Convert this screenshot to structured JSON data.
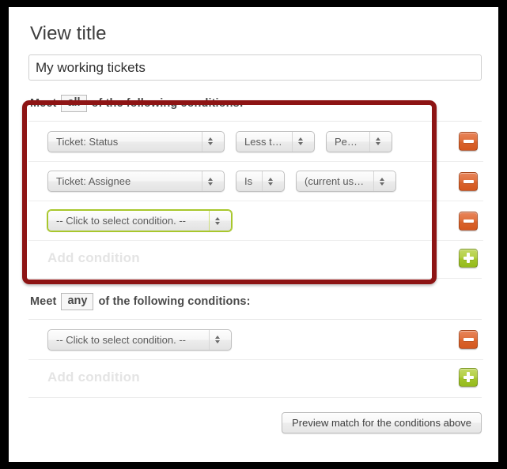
{
  "form": {
    "title_label": "View title",
    "title_value": "My working tickets",
    "title_placeholder": "View title"
  },
  "sections": [
    {
      "meet_prefix": "Meet",
      "operator": "all",
      "meet_suffix": "of the following conditions:",
      "add_label": "Add condition",
      "conditions": [
        {
          "field": "Ticket: Status",
          "operator": "Less than",
          "value": "Pending",
          "remove_label": "Remove condition",
          "focused": false
        },
        {
          "field": "Ticket: Assignee",
          "operator": "Is",
          "value": "(current user)",
          "remove_label": "Remove condition",
          "focused": false
        },
        {
          "field": "-- Click to select condition. --",
          "operator": "",
          "value": "",
          "remove_label": "Remove condition",
          "focused": true
        }
      ]
    },
    {
      "meet_prefix": "Meet",
      "operator": "any",
      "meet_suffix": "of the following conditions:",
      "add_label": "Add condition",
      "conditions": [
        {
          "field": "-- Click to select condition. --",
          "operator": "",
          "value": "",
          "remove_label": "Remove condition",
          "focused": false
        }
      ]
    }
  ],
  "footer": {
    "preview_label": "Preview match for the conditions above"
  },
  "annotation": {
    "color": "#8d1414"
  },
  "colors": {
    "minus_button": "#d9632c",
    "plus_button": "#a3c52c",
    "focus_outline": "#a8c72c",
    "title_text": "#3d3d3d",
    "add_link": "#e4e4e4"
  }
}
